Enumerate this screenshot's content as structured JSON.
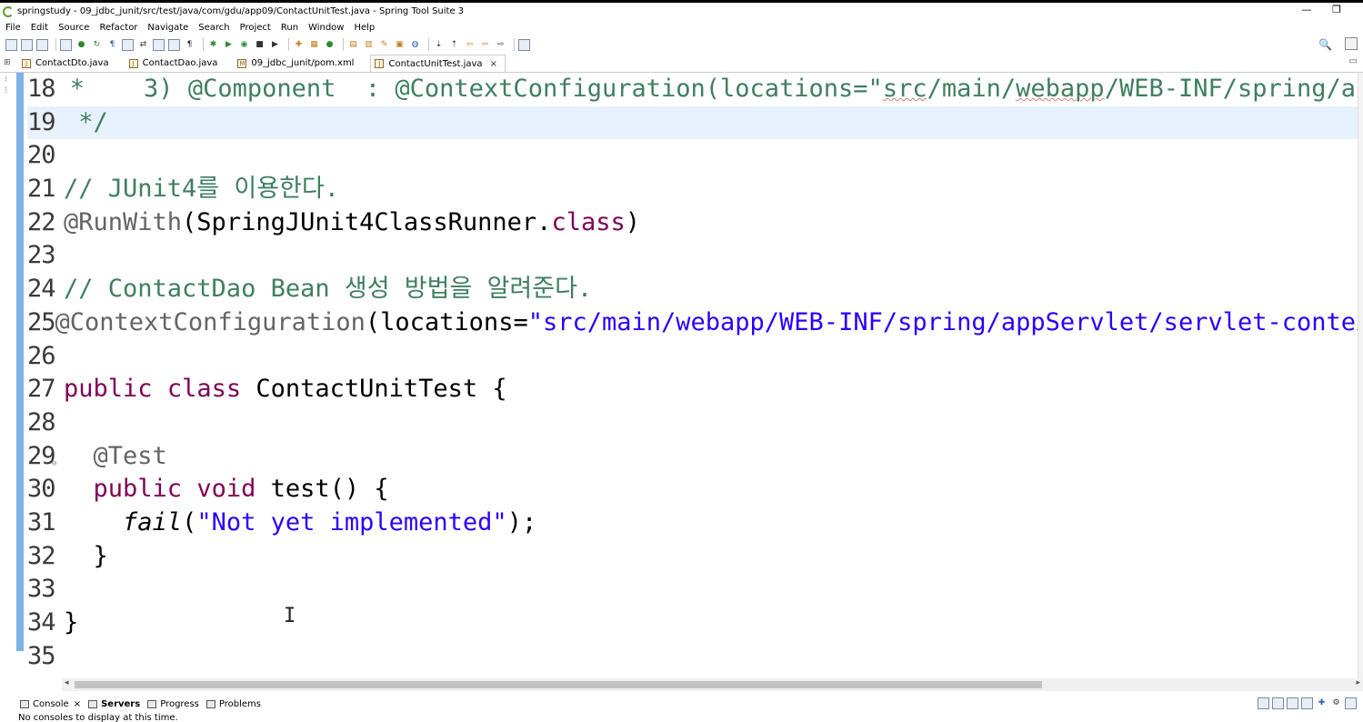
{
  "window": {
    "title": "springstudy - 09_jdbc_junit/src/test/java/com/gdu/app09/ContactUnitTest.java - Spring Tool Suite 3",
    "minimize": "—",
    "restore": "❐"
  },
  "menu": [
    "File",
    "Edit",
    "Source",
    "Refactor",
    "Navigate",
    "Search",
    "Project",
    "Run",
    "Window",
    "Help"
  ],
  "editor_tabs": [
    {
      "label": "ContactDto.java",
      "icon": "J"
    },
    {
      "label": "ContactDao.java",
      "icon": "J"
    },
    {
      "label": "09_jdbc_junit/pom.xml",
      "icon": "M"
    },
    {
      "label": "ContactUnitTest.java",
      "icon": "J",
      "active": true,
      "close": "×"
    }
  ],
  "code_lines": [
    {
      "n": "18",
      "parts": [
        {
          "c": "cmt",
          "t": " *    3) @Component  : @ContextConfiguration(locations=\""
        },
        {
          "c": "cmt squiggle",
          "t": "src"
        },
        {
          "c": "cmt",
          "t": "/main/"
        },
        {
          "c": "cmt squiggle",
          "t": "webapp"
        },
        {
          "c": "cmt",
          "t": "/WEB-INF/spring/app"
        }
      ]
    },
    {
      "n": "19",
      "current": true,
      "parts": [
        {
          "c": "cmt",
          "t": " */"
        }
      ]
    },
    {
      "n": "20",
      "parts": []
    },
    {
      "n": "21",
      "parts": [
        {
          "c": "cmt",
          "t": "// JUnit4를 이용한다."
        }
      ]
    },
    {
      "n": "22",
      "parts": [
        {
          "c": "ann",
          "t": "@RunWith"
        },
        {
          "c": "txt",
          "t": "(SpringJUnit4ClassRunner."
        },
        {
          "c": "kw",
          "t": "class"
        },
        {
          "c": "txt",
          "t": ")"
        }
      ]
    },
    {
      "n": "23",
      "parts": []
    },
    {
      "n": "24",
      "parts": [
        {
          "c": "cmt",
          "t": "// ContactDao Bean 생성 방법을 알려준다."
        }
      ]
    },
    {
      "n": "25",
      "parts": [
        {
          "c": "ann",
          "t": "@ContextConfiguration"
        },
        {
          "c": "txt",
          "t": "(locations="
        },
        {
          "c": "str",
          "t": "\"src/main/webapp/WEB-INF/spring/appServlet/servlet-context"
        }
      ]
    },
    {
      "n": "26",
      "parts": []
    },
    {
      "n": "27",
      "parts": [
        {
          "c": "kw",
          "t": "public"
        },
        {
          "c": "txt",
          "t": " "
        },
        {
          "c": "kw",
          "t": "class"
        },
        {
          "c": "txt",
          "t": " ContactUnitTest {"
        }
      ]
    },
    {
      "n": "28",
      "parts": []
    },
    {
      "n": "29",
      "fold": true,
      "parts": [
        {
          "c": "txt",
          "t": "  "
        },
        {
          "c": "ann",
          "t": "@Test"
        }
      ]
    },
    {
      "n": "30",
      "parts": [
        {
          "c": "txt",
          "t": "  "
        },
        {
          "c": "kw",
          "t": "public"
        },
        {
          "c": "txt",
          "t": " "
        },
        {
          "c": "kw",
          "t": "void"
        },
        {
          "c": "txt",
          "t": " test() {"
        }
      ]
    },
    {
      "n": "31",
      "parts": [
        {
          "c": "txt",
          "t": "    "
        },
        {
          "c": "txt it",
          "t": "fail"
        },
        {
          "c": "txt",
          "t": "("
        },
        {
          "c": "str",
          "t": "\"Not yet implemented\""
        },
        {
          "c": "txt",
          "t": ");"
        }
      ]
    },
    {
      "n": "32",
      "parts": [
        {
          "c": "txt",
          "t": "  }"
        }
      ]
    },
    {
      "n": "33",
      "parts": []
    },
    {
      "n": "34",
      "parts": [
        {
          "c": "txt",
          "t": "}"
        }
      ]
    },
    {
      "n": "35",
      "parts": []
    }
  ],
  "bottom_tabs": [
    {
      "label": "Console",
      "name": "console",
      "close": "×"
    },
    {
      "label": "Servers",
      "name": "servers",
      "bold": true
    },
    {
      "label": "Progress",
      "name": "progress"
    },
    {
      "label": "Problems",
      "name": "problems"
    }
  ],
  "status_text": "No consoles to display at this time.",
  "icons": {
    "search": "🔍",
    "text_cursor": "I",
    "scroll_left": "◂",
    "scroll_right": "▸"
  }
}
